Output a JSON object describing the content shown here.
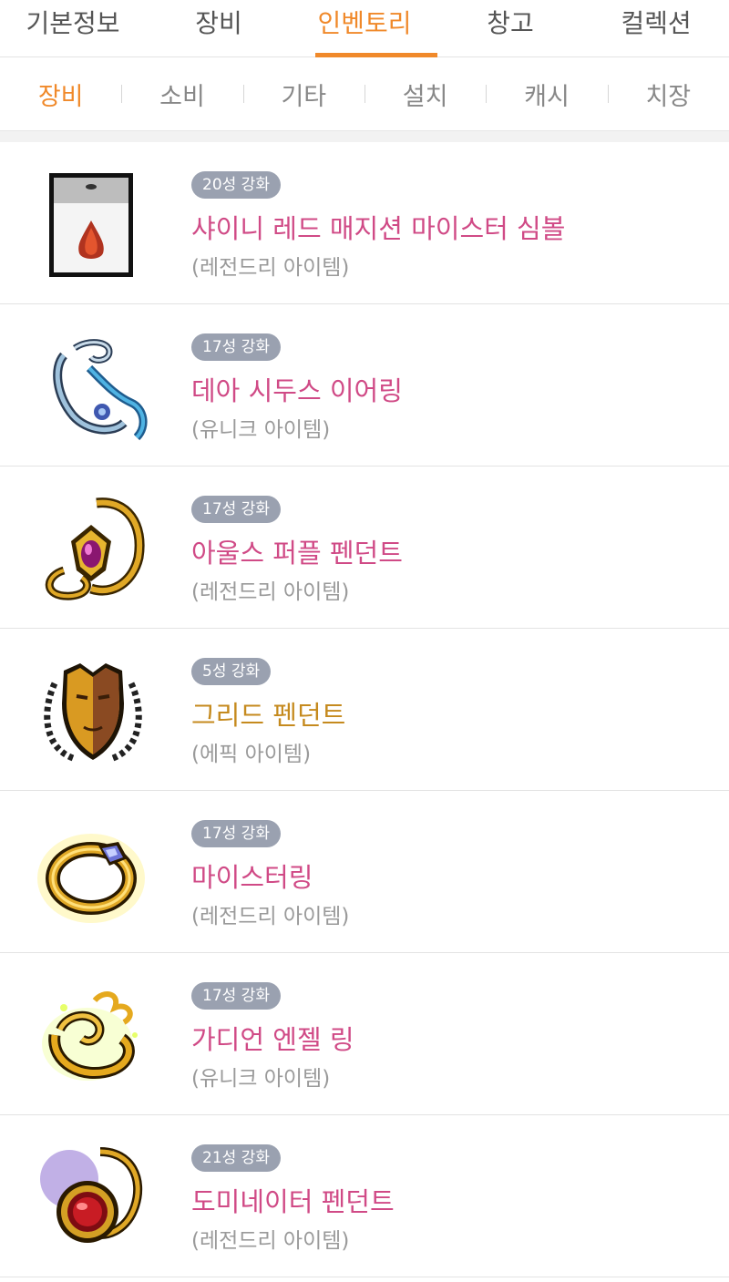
{
  "top_tabs": [
    {
      "label": "기본정보",
      "active": false
    },
    {
      "label": "장비",
      "active": false
    },
    {
      "label": "인벤토리",
      "active": true
    },
    {
      "label": "창고",
      "active": false
    },
    {
      "label": "컬렉션",
      "active": false
    }
  ],
  "sub_tabs": [
    {
      "label": "장비",
      "active": true
    },
    {
      "label": "소비",
      "active": false
    },
    {
      "label": "기타",
      "active": false
    },
    {
      "label": "설치",
      "active": false
    },
    {
      "label": "캐시",
      "active": false
    },
    {
      "label": "치장",
      "active": false
    }
  ],
  "items": [
    {
      "star": "20성 강화",
      "name": "샤이니 레드 매지션 마이스터 심볼",
      "grade": "(레전드리 아이템)",
      "name_color": "#d04a86",
      "icon": "symbol-card-icon"
    },
    {
      "star": "17성 강화",
      "name": "데아 시두스 이어링",
      "grade": "(유니크 아이템)",
      "name_color": "#d04a86",
      "icon": "earring-icon"
    },
    {
      "star": "17성 강화",
      "name": "아울스 퍼플 펜던트",
      "grade": "(레전드리 아이템)",
      "name_color": "#d04a86",
      "icon": "purple-pendant-icon"
    },
    {
      "star": "5성 강화",
      "name": "그리드 펜던트",
      "grade": "(에픽 아이템)",
      "name_color": "#c58a1e",
      "icon": "greed-pendant-icon"
    },
    {
      "star": "17성 강화",
      "name": "마이스터링",
      "grade": "(레전드리 아이템)",
      "name_color": "#d04a86",
      "icon": "meister-ring-icon"
    },
    {
      "star": "17성 강화",
      "name": "가디언 엔젤 링",
      "grade": "(유니크 아이템)",
      "name_color": "#d04a86",
      "icon": "angel-ring-icon"
    },
    {
      "star": "21성 강화",
      "name": "도미네이터 펜던트",
      "grade": "(레전드리 아이템)",
      "name_color": "#d04a86",
      "icon": "dominator-pendant-icon"
    }
  ]
}
